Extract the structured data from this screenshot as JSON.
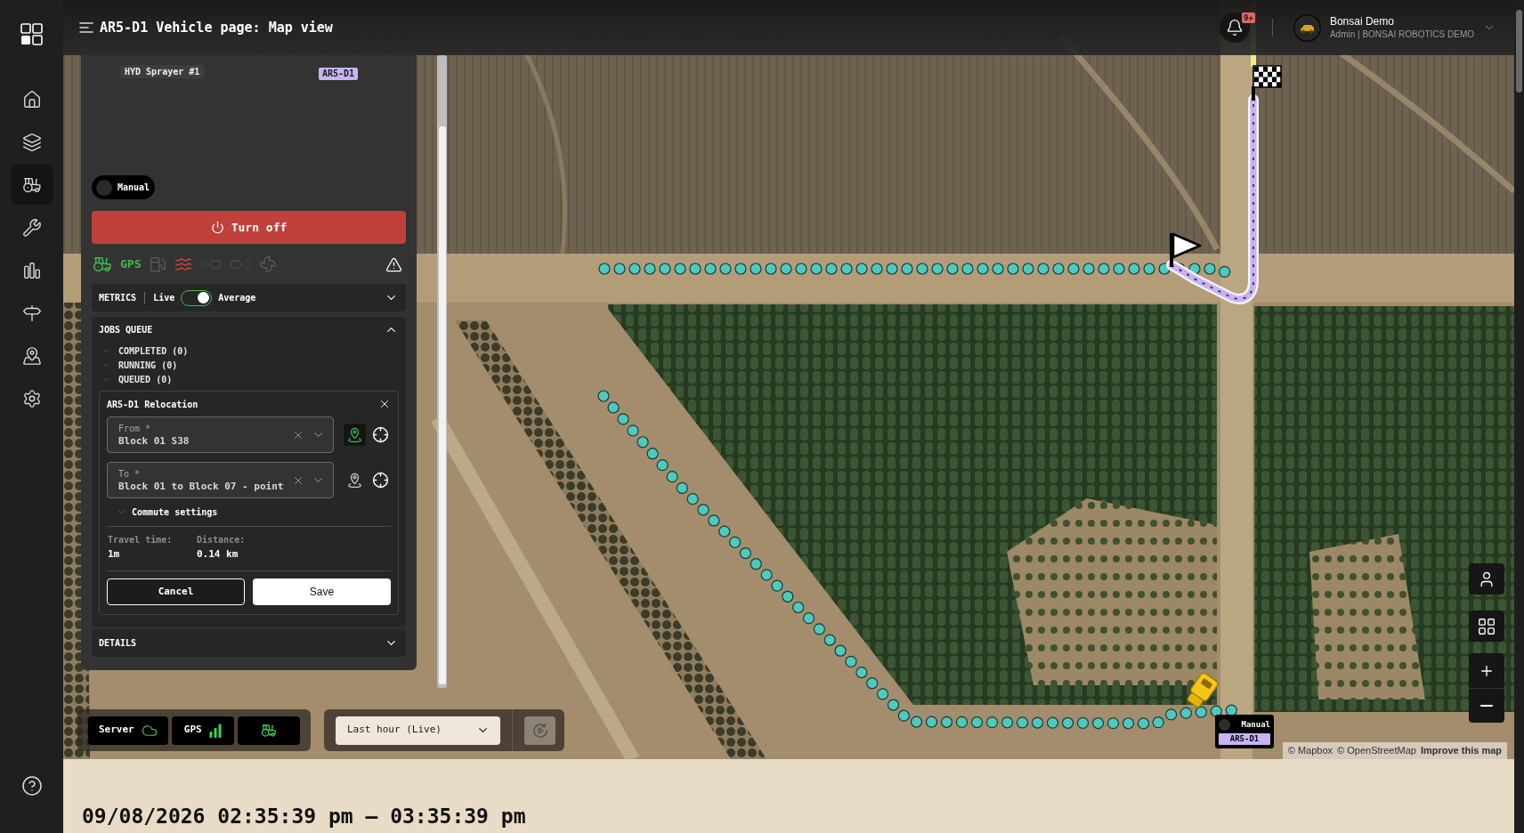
{
  "sidebar": {
    "items": [
      {
        "selected": false
      },
      {
        "selected": false
      },
      {
        "selected": true
      },
      {
        "selected": false
      },
      {
        "selected": false
      },
      {
        "selected": false
      },
      {
        "selected": false
      },
      {
        "selected": false
      }
    ]
  },
  "header": {
    "title": "AR5-D1 Vehicle page: Map view",
    "notification_badge": "9+",
    "user": {
      "name": "Bonsai Demo",
      "role": "Admin | BONSAI ROBOTICS DEMO"
    }
  },
  "vehicle_panel": {
    "vehicle_name": "HYD Sprayer #1",
    "vehicle_id": "AR5-D1",
    "mode_switch": {
      "label": "Manual",
      "on": false
    },
    "turn_off_button": "Turn off",
    "status_indicators": [
      {
        "kind": "icon",
        "color": "#3fb950"
      },
      {
        "kind": "text",
        "label": "GPS",
        "color": "#3fb950"
      },
      {
        "kind": "icon",
        "color": "#5c5c5c"
      },
      {
        "kind": "icon",
        "color": "#d9453d"
      },
      {
        "kind": "icon",
        "color": "#4a4a4a"
      },
      {
        "kind": "icon",
        "color": "#4a4a4a"
      },
      {
        "kind": "icon",
        "color": "#5c5c5c"
      }
    ],
    "metrics": {
      "title": "METRICS",
      "live_label": "Live",
      "average_label": "Average",
      "average_on": true,
      "expanded": false
    },
    "jobs_queue": {
      "title": "JOBS QUEUE",
      "expanded": true,
      "groups": [
        {
          "label": "COMPLETED (0)"
        },
        {
          "label": "RUNNING (0)"
        },
        {
          "label": "QUEUED (0)"
        }
      ],
      "job": {
        "title": "AR5-D1 Relocation",
        "from": {
          "label": "From *",
          "value": "Block 01 S38",
          "pin_selected": true
        },
        "to": {
          "label": "To *",
          "value": "Block 01 to Block 07 - point",
          "pin_selected": false
        },
        "commute_settings": {
          "label": "Commute settings",
          "expanded": false
        },
        "travel_time": {
          "label": "Travel time:",
          "value": "1m"
        },
        "distance": {
          "label": "Distance:",
          "value": "0.14 km"
        },
        "cancel_button": "Cancel",
        "save_button": "Save"
      }
    },
    "details": {
      "title": "DETAILS",
      "expanded": false
    }
  },
  "map": {
    "status_tiles": [
      {
        "label": "Server",
        "connected": true
      },
      {
        "label": "GPS",
        "connected": true
      },
      {
        "connected": true
      }
    ],
    "time_range": {
      "value": "Last hour (Live)"
    },
    "vehicle_marker": {
      "mode": "Manual",
      "vehicle_id": "AR5-D1"
    },
    "attribution": [
      {
        "kind": "text",
        "label": "© Mapbox"
      },
      {
        "kind": "text",
        "label": "© OpenStreetMap"
      },
      {
        "kind": "link",
        "label": "Improve this map"
      }
    ]
  },
  "footer": {
    "time_range": "09/08/2026 02:35:39 pm — 03:35:39 pm"
  }
}
